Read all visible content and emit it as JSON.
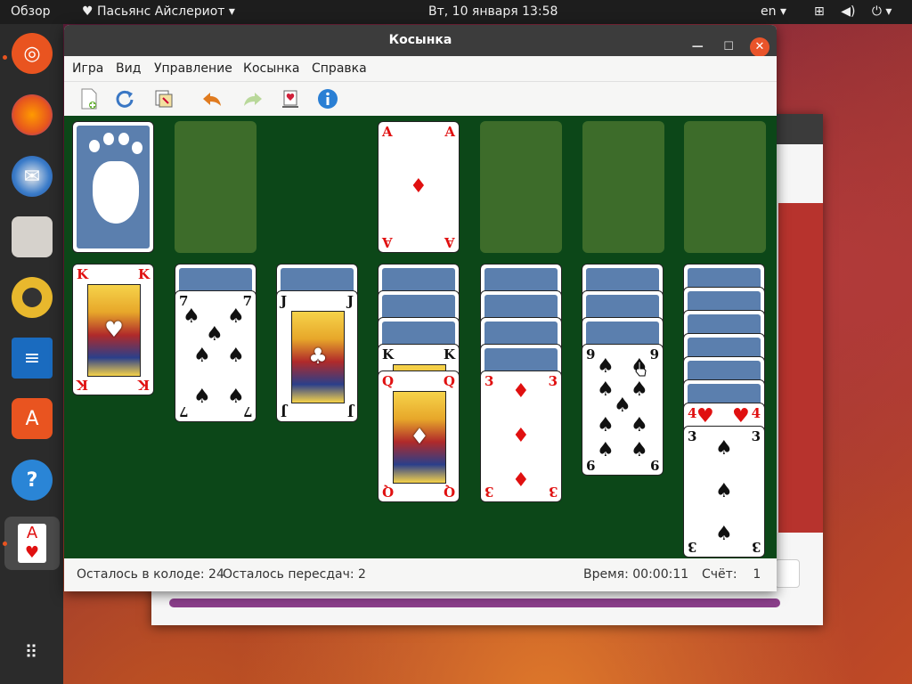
{
  "topbar": {
    "activities": "Обзор",
    "app_name": "Пасьянс Айслериот",
    "clock": "Вт, 10 января  13:58",
    "lang": "en",
    "tray_icons": [
      "network-icon",
      "volume-icon",
      "power-icon"
    ]
  },
  "dock": {
    "items": [
      {
        "name": "ubuntu-software-updater-icon"
      },
      {
        "name": "firefox-icon"
      },
      {
        "name": "thunderbird-icon"
      },
      {
        "name": "files-icon"
      },
      {
        "name": "rhythmbox-icon"
      },
      {
        "name": "libreoffice-writer-icon"
      },
      {
        "name": "ubuntu-software-icon"
      },
      {
        "name": "help-icon"
      },
      {
        "name": "aisleriot-icon"
      },
      {
        "name": "show-apps-icon"
      }
    ]
  },
  "window": {
    "title": "Косынка",
    "menu": [
      "Игра",
      "Вид",
      "Управление",
      "Косынка",
      "Справка"
    ],
    "toolbar": [
      "new-game-icon",
      "restart-icon",
      "select-game-icon",
      "undo-icon",
      "redo-icon",
      "hint-icon",
      "info-icon"
    ]
  },
  "board": {
    "foundation_top": {
      "rank": "A",
      "suit": "♦",
      "color": "red"
    },
    "tableau": [
      {
        "hidden": 0,
        "up": [
          {
            "rank": "K",
            "suit": "♥",
            "color": "red",
            "face": true
          }
        ]
      },
      {
        "hidden": 1,
        "up": [
          {
            "rank": "7",
            "suit": "♠",
            "color": "black"
          }
        ]
      },
      {
        "hidden": 1,
        "up": [
          {
            "rank": "J",
            "suit": "♣",
            "color": "black",
            "face": true
          }
        ]
      },
      {
        "hidden": 3,
        "up": [
          {
            "rank": "K",
            "suit": "♠",
            "color": "black",
            "face": true
          },
          {
            "rank": "Q",
            "suit": "♦",
            "color": "red",
            "face": true
          }
        ]
      },
      {
        "hidden": 4,
        "up": [
          {
            "rank": "3",
            "suit": "♦",
            "color": "red"
          }
        ]
      },
      {
        "hidden": 3,
        "up": [
          {
            "rank": "9",
            "suit": "♠",
            "color": "black"
          }
        ]
      },
      {
        "hidden": 6,
        "up": [
          {
            "rank": "4",
            "suit": "♥",
            "color": "red"
          },
          {
            "rank": "3",
            "suit": "♠",
            "color": "black"
          }
        ]
      }
    ]
  },
  "status": {
    "deck_left": "Осталось в колоде: 24",
    "redeals_left": "Осталось пересдач: 2",
    "time": "Время: 00:00:11",
    "score": "Счёт:    1"
  }
}
